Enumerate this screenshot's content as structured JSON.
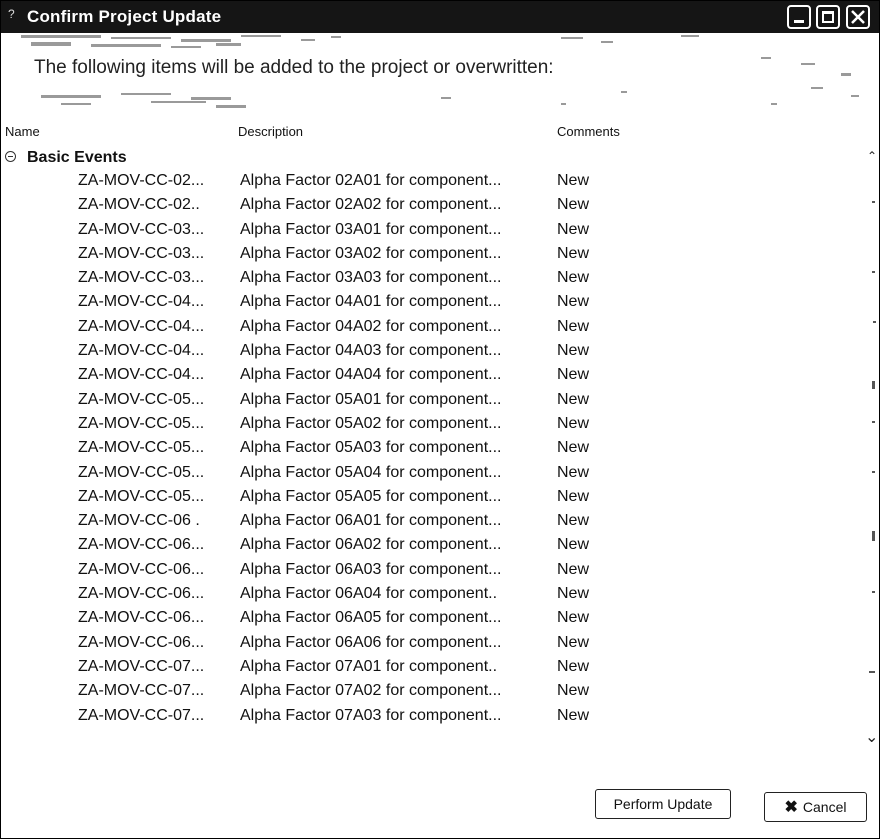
{
  "window": {
    "title": "Confirm Project Update",
    "title_glyph": "?",
    "controls": [
      "minimize-icon",
      "maximize-icon",
      "close-icon"
    ]
  },
  "banner": {
    "text": "The following items will be added to the project or overwritten:"
  },
  "columns": {
    "name": "Name",
    "description": "Description",
    "comments": "Comments"
  },
  "group": {
    "label": "Basic Events",
    "expanded": true
  },
  "rows": [
    {
      "name": "ZA-MOV-CC-02...",
      "description": "Alpha Factor 02A01 for component...",
      "comment": "New"
    },
    {
      "name": "ZA-MOV-CC-02..",
      "description": "Alpha Factor 02A02 for component...",
      "comment": "New"
    },
    {
      "name": "ZA-MOV-CC-03...",
      "description": "Alpha Factor 03A01 for component...",
      "comment": "New"
    },
    {
      "name": "ZA-MOV-CC-03...",
      "description": "Alpha Factor 03A02 for component...",
      "comment": "New"
    },
    {
      "name": "ZA-MOV-CC-03...",
      "description": "Alpha Factor 03A03 for component...",
      "comment": "New"
    },
    {
      "name": "ZA-MOV-CC-04...",
      "description": "Alpha Factor 04A01 for component...",
      "comment": "New"
    },
    {
      "name": "ZA-MOV-CC-04...",
      "description": "Alpha Factor 04A02 for component...",
      "comment": "New"
    },
    {
      "name": "ZA-MOV-CC-04...",
      "description": "Alpha Factor 04A03 for component...",
      "comment": "New"
    },
    {
      "name": "ZA-MOV-CC-04...",
      "description": "Alpha Factor 04A04 for component...",
      "comment": "New"
    },
    {
      "name": "ZA-MOV-CC-05...",
      "description": "Alpha Factor 05A01 for component...",
      "comment": "New"
    },
    {
      "name": "ZA-MOV-CC-05...",
      "description": "Alpha Factor 05A02 for component...",
      "comment": "New"
    },
    {
      "name": "ZA-MOV-CC-05...",
      "description": "Alpha Factor 05A03 for component...",
      "comment": "New"
    },
    {
      "name": "ZA-MOV-CC-05...",
      "description": "Alpha Factor 05A04 for component...",
      "comment": "New"
    },
    {
      "name": "ZA-MOV-CC-05...",
      "description": "Alpha Factor 05A05 for component...",
      "comment": "New"
    },
    {
      "name": "ZA-MOV-CC-06 .",
      "description": "Alpha Factor 06A01 for component...",
      "comment": "New"
    },
    {
      "name": "ZA-MOV-CC-06...",
      "description": "Alpha Factor 06A02 for component...",
      "comment": "New"
    },
    {
      "name": "ZA-MOV-CC-06...",
      "description": "Alpha Factor 06A03 for component...",
      "comment": "New"
    },
    {
      "name": "ZA-MOV-CC-06...",
      "description": "Alpha Factor 06A04 for component..",
      "comment": "New"
    },
    {
      "name": "ZA-MOV-CC-06...",
      "description": "Alpha Factor 06A05 for component...",
      "comment": "New"
    },
    {
      "name": "ZA-MOV-CC-06...",
      "description": "Alpha Factor 06A06 for component...",
      "comment": "New"
    },
    {
      "name": "ZA-MOV-CC-07...",
      "description": "Alpha Factor 07A01 for component..",
      "comment": "New"
    },
    {
      "name": "ZA-MOV-CC-07...",
      "description": "Alpha Factor 07A02 for component...",
      "comment": "New"
    },
    {
      "name": "ZA-MOV-CC-07...",
      "description": "Alpha Factor 07A03 for component...",
      "comment": "New"
    }
  ],
  "footer": {
    "perform_label": "Perform Update",
    "cancel_label": "Cancel"
  },
  "colors": {
    "titlebar": "#151515",
    "text": "#111111"
  }
}
